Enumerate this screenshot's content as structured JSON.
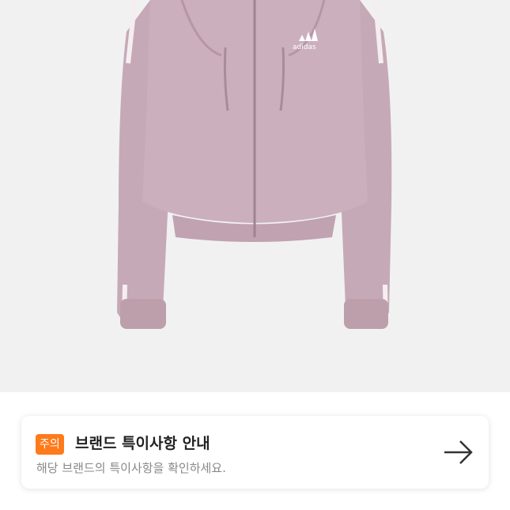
{
  "product": {
    "image_description": "pink cropped hooded jacket",
    "brand_logo_text": "adidas",
    "colors": {
      "jacket": "#c8aab7",
      "background": "#f1f1f2"
    }
  },
  "notice": {
    "badge": "주의",
    "title": "브랜드 특이사항 안내",
    "description": "해당 브랜드의 특이사항을 확인하세요.",
    "arrow_icon": "arrow-right-icon",
    "colors": {
      "badge": "#ff7a1a",
      "title": "#222222",
      "description": "#888888"
    }
  }
}
